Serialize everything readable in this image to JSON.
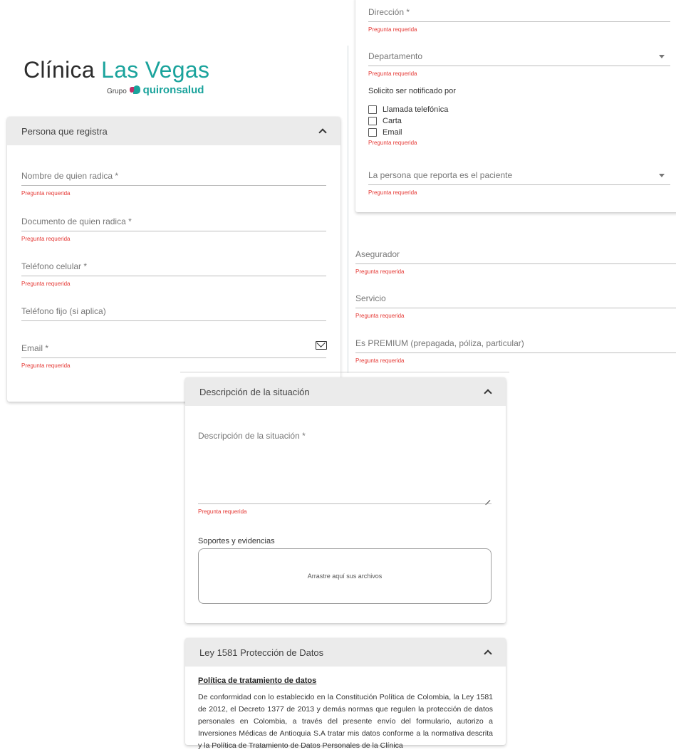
{
  "logo": {
    "part1": "Clínica ",
    "part2": "Las Vegas",
    "grupo": "Grupo",
    "brand": "quironsalud",
    "accent_color": "#1aa39c"
  },
  "left_panel": {
    "title": "Persona que registra",
    "fields": [
      {
        "label": "Nombre de quien radica *",
        "error": "Pregunta requerida"
      },
      {
        "label": "Documento de quien radica *",
        "error": "Pregunta requerida"
      },
      {
        "label": "Teléfono celular *",
        "error": "Pregunta requerida"
      },
      {
        "label": "Teléfono fijo (si aplica)"
      },
      {
        "label": "Email *",
        "error": "Pregunta requerida",
        "icon": "mail-icon"
      }
    ]
  },
  "right_panel": {
    "direccion": {
      "label": "Dirección *",
      "error": "Pregunta requerida"
    },
    "departamento": {
      "label": "Departamento",
      "error": "Pregunta requerida"
    },
    "notificado": {
      "title": "Solicito ser notificado por",
      "options": [
        "Llamada telefónica",
        "Carta",
        "Email"
      ],
      "error": "Pregunta requerida"
    },
    "persona_reporta": {
      "label": "La persona que reporta es el paciente",
      "error": "Pregunta requerida"
    }
  },
  "right_fields": [
    {
      "label": "Asegurador",
      "error": "Pregunta requerida"
    },
    {
      "label": "Servicio",
      "error": "Pregunta requerida"
    },
    {
      "label": "Es PREMIUM (prepagada, póliza, particular)",
      "error": "Pregunta requerida"
    }
  ],
  "descripcion_panel": {
    "title": "Descripción de la situación",
    "field_label": "Descripción de la situación *",
    "error": "Pregunta requerida",
    "soportes_label": "Soportes y evidencias",
    "dropzone_text": "Arrastre aquí sus archivos"
  },
  "ley_panel": {
    "title": "Ley 1581 Protección de Datos",
    "policy_title": "Política de tratamiento de datos",
    "policy_text": "De conformidad con lo establecido en la Constitución Política de Colombia, la Ley 1581 de 2012, el Decreto 1377 de 2013 y demás normas que regulen la protección de datos personales en Colombia, a través del presente envío del formulario, autorizo a Inversiones Médicas de Antioquia S.A tratar mis datos conforme a la normativa descrita y la Política de Tratamiento de Datos Personales de la Clínica"
  }
}
